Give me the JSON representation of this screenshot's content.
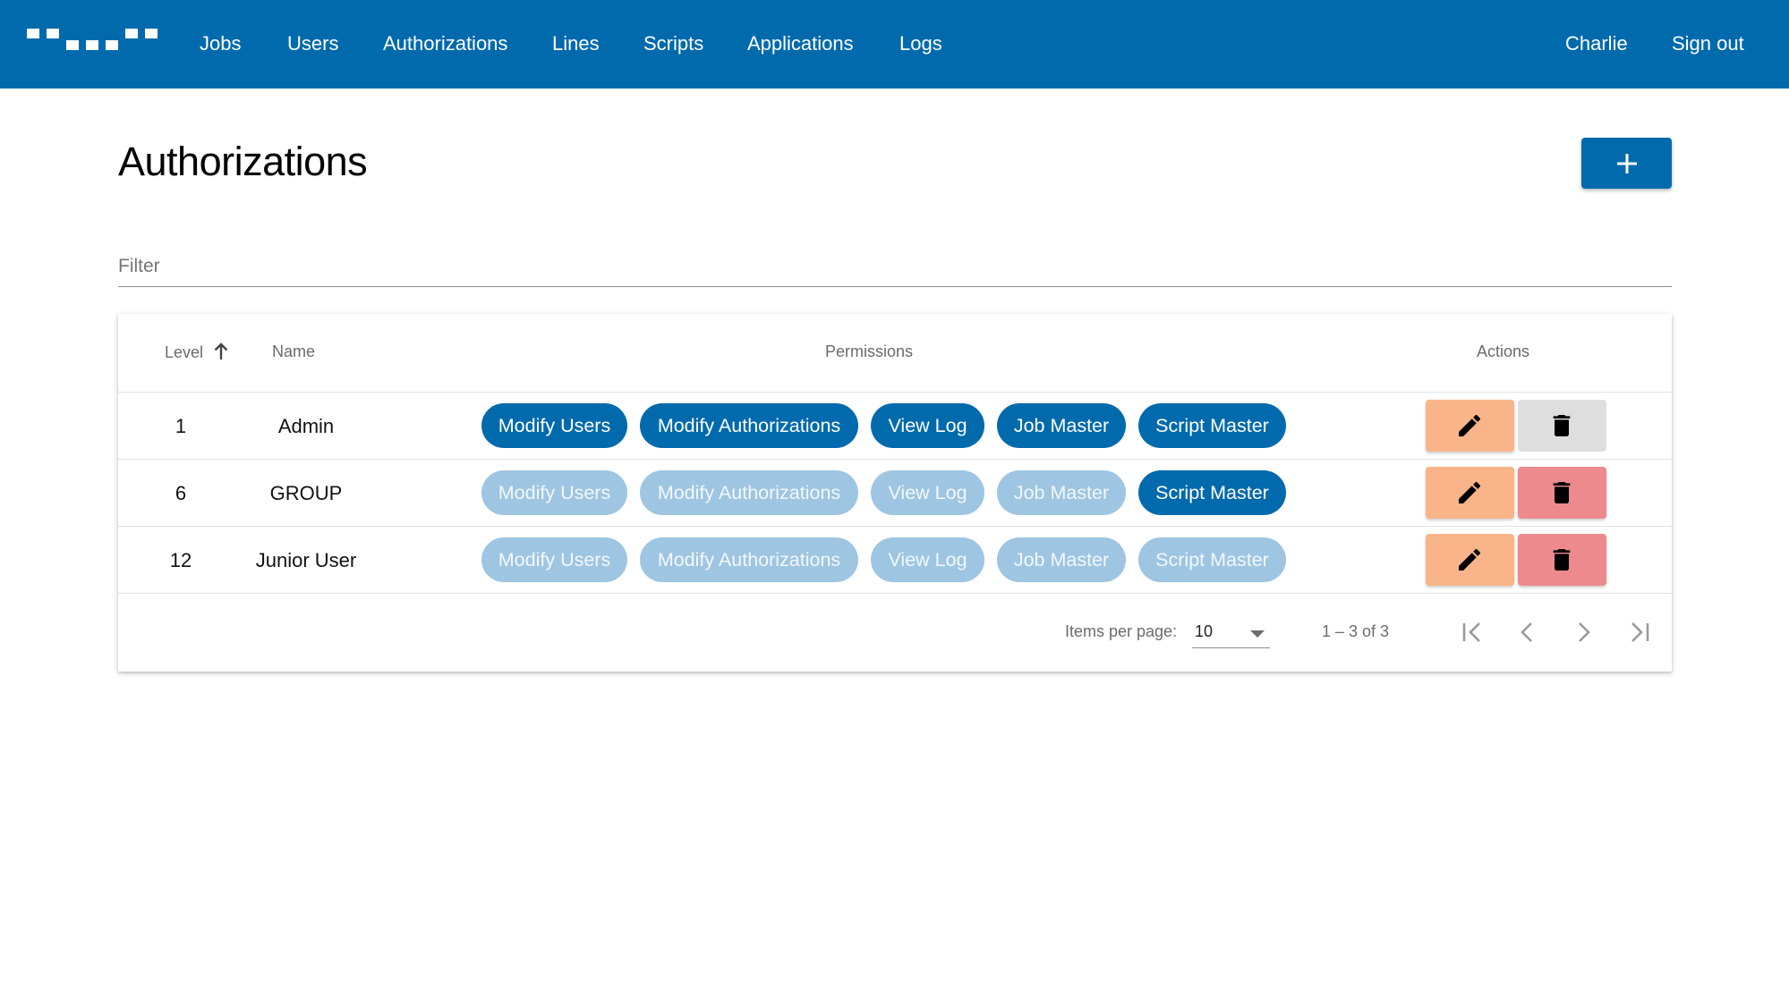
{
  "nav": {
    "items": [
      {
        "label": "Jobs"
      },
      {
        "label": "Users"
      },
      {
        "label": "Authorizations"
      },
      {
        "label": "Lines"
      },
      {
        "label": "Scripts"
      },
      {
        "label": "Applications"
      },
      {
        "label": "Logs"
      }
    ],
    "user": "Charlie",
    "sign_out": "Sign out"
  },
  "page": {
    "title": "Authorizations",
    "add_icon": "plus-icon"
  },
  "filter": {
    "placeholder": "Filter",
    "value": ""
  },
  "table": {
    "headers": {
      "level": "Level",
      "name": "Name",
      "permissions": "Permissions",
      "actions": "Actions"
    },
    "sort": {
      "column": "Level",
      "direction": "ascending",
      "icon": "arrow-up-icon"
    },
    "permission_labels": [
      "Modify Users",
      "Modify Authorizations",
      "View Log",
      "Job Master",
      "Script Master"
    ],
    "rows": [
      {
        "level": "1",
        "name": "Admin",
        "permissions": [
          true,
          true,
          true,
          true,
          true
        ],
        "delete_enabled": false
      },
      {
        "level": "6",
        "name": "GROUP",
        "permissions": [
          false,
          false,
          false,
          false,
          true
        ],
        "delete_enabled": true
      },
      {
        "level": "12",
        "name": "Junior User",
        "permissions": [
          false,
          false,
          false,
          false,
          false
        ],
        "delete_enabled": true
      }
    ]
  },
  "paginator": {
    "items_per_page_label": "Items per page:",
    "page_size": "10",
    "range_label": "1 – 3 of 3"
  },
  "colors": {
    "primary": "#006aad",
    "chip_inactive": "#9ec5e2",
    "edit": "#f9b489",
    "delete": "#ec8a8e",
    "delete_disabled": "#dedede"
  }
}
